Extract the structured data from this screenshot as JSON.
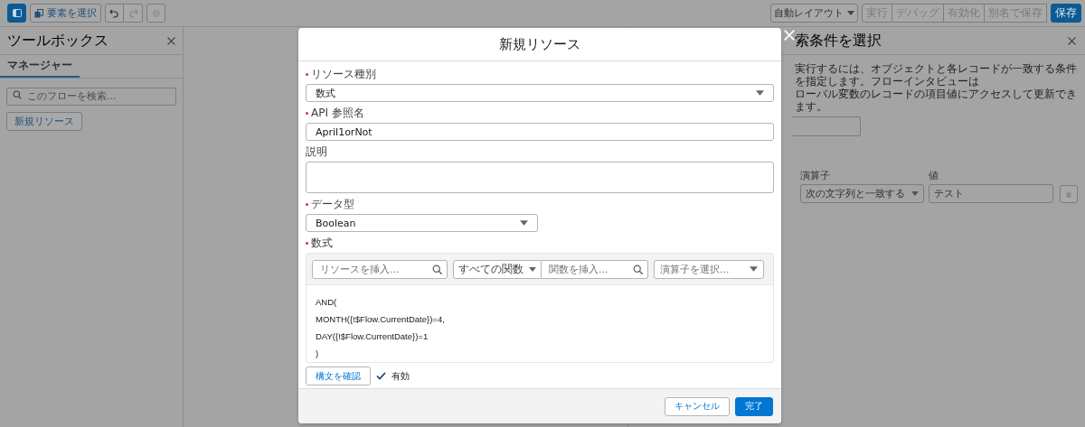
{
  "toolbar": {
    "toolbox_toggle": {
      "selected": true
    },
    "select_elements": "要素を選択",
    "undo": {
      "disabled": false
    },
    "redo": {
      "disabled": true
    },
    "settings": {
      "disabled": true
    },
    "layout_select": "自動レイアウト",
    "actions": [
      {
        "label": "実行",
        "kind": "neutral",
        "disabled": true
      },
      {
        "label": "デバッグ",
        "kind": "neutral",
        "disabled": true
      },
      {
        "label": "有効化",
        "kind": "neutral",
        "disabled": true
      },
      {
        "label": "別名で保存",
        "kind": "neutral",
        "disabled": true
      },
      {
        "label": "保存",
        "kind": "primary",
        "disabled": false
      }
    ]
  },
  "toolbox": {
    "title": "ツールボックス",
    "tabs": [
      {
        "label": "マネージャー",
        "selected": true
      }
    ],
    "search": {
      "placeholder": "このフローを検索..."
    },
    "new_resource_button": "新規リソース"
  },
  "right_panel": {
    "title": "索条件を選択",
    "description_lines": [
      "実行するには、オブジェクトと各レコードが一致する条件を指定します。フローインタビューは",
      "ローバル変数のレコードの項目値にアクセスして更新できます。"
    ],
    "condition": {
      "operator_label": "演算子",
      "value_label": "値",
      "operator": "次の文字列と一致する",
      "value": "テスト"
    }
  },
  "modal": {
    "title": "新規リソース",
    "fields": [
      {
        "kind": "select",
        "label": "リソース種別",
        "required": true,
        "value": "数式"
      },
      {
        "kind": "text",
        "label": "API 参照名",
        "required": true,
        "value": "April1orNot"
      },
      {
        "kind": "textarea",
        "label": "説明",
        "required": false
      },
      {
        "kind": "short-select",
        "label": "データ型",
        "required": true,
        "value": "Boolean"
      }
    ],
    "formula": {
      "label": "数式",
      "required": true,
      "resource_search": {
        "placeholder": "リソースを挿入..."
      },
      "function_filter": "すべての関数",
      "function_search": {
        "placeholder": "関数を挿入..."
      },
      "operator_select": {
        "placeholder": "演算子を選択..."
      },
      "lines": [
        "AND(",
        "MONTH({!$Flow.CurrentDate})=4,",
        "DAY({!$Flow.CurrentDate})=1",
        ")"
      ]
    },
    "check_syntax_button": "構文を確認",
    "validation": {
      "valid": true,
      "text": "有効"
    },
    "buttons": [
      {
        "label": "キャンセル",
        "kind": "neutral"
      },
      {
        "label": "完了",
        "kind": "brand"
      }
    ]
  }
}
